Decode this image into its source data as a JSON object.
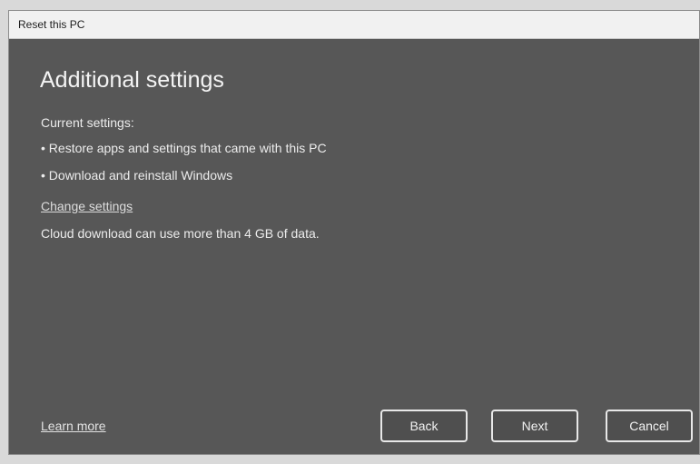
{
  "window": {
    "title": "Reset this PC"
  },
  "page": {
    "title": "Additional settings",
    "current_settings_label": "Current settings:",
    "bullets": [
      "• Restore apps and settings that came with this PC",
      "• Download and reinstall Windows"
    ],
    "change_settings_link": "Change settings",
    "cloud_note": "Cloud download can use more than 4 GB of data."
  },
  "footer": {
    "learn_more_link": "Learn more",
    "back_label": "Back",
    "next_label": "Next",
    "cancel_label": "Cancel"
  }
}
